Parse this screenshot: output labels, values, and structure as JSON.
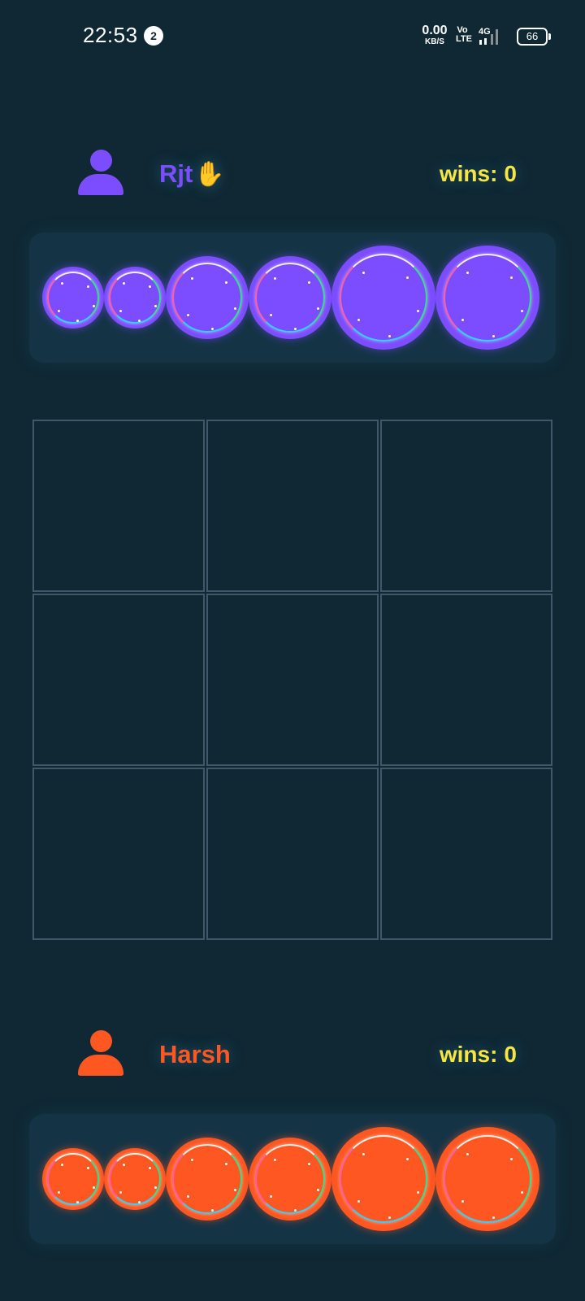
{
  "status_bar": {
    "time": "22:53",
    "notification_count": "2",
    "net_speed_value": "0.00",
    "net_speed_unit": "KB/S",
    "volte_line1": "Vo",
    "volte_line2": "LTE",
    "network_type": "4G",
    "battery_level": "66"
  },
  "players": {
    "top": {
      "name": "Rjt",
      "turn_icon": "✋",
      "wins_label": "wins:",
      "wins_value": "0",
      "color": "#7c4dff",
      "pieces": [
        "small",
        "small",
        "medium",
        "medium",
        "large",
        "large"
      ]
    },
    "bottom": {
      "name": "Harsh",
      "wins_label": "wins:",
      "wins_value": "0",
      "color": "#ff5722",
      "pieces": [
        "small",
        "small",
        "medium",
        "medium",
        "large",
        "large"
      ]
    }
  },
  "board": {
    "rows": 3,
    "cols": 3,
    "cells": [
      "",
      "",
      "",
      "",
      "",
      "",
      "",
      "",
      ""
    ]
  },
  "theme": {
    "background": "#0f2833",
    "tray": "#143446",
    "grid_line": "#42586a",
    "wins_color": "#f5e642"
  }
}
